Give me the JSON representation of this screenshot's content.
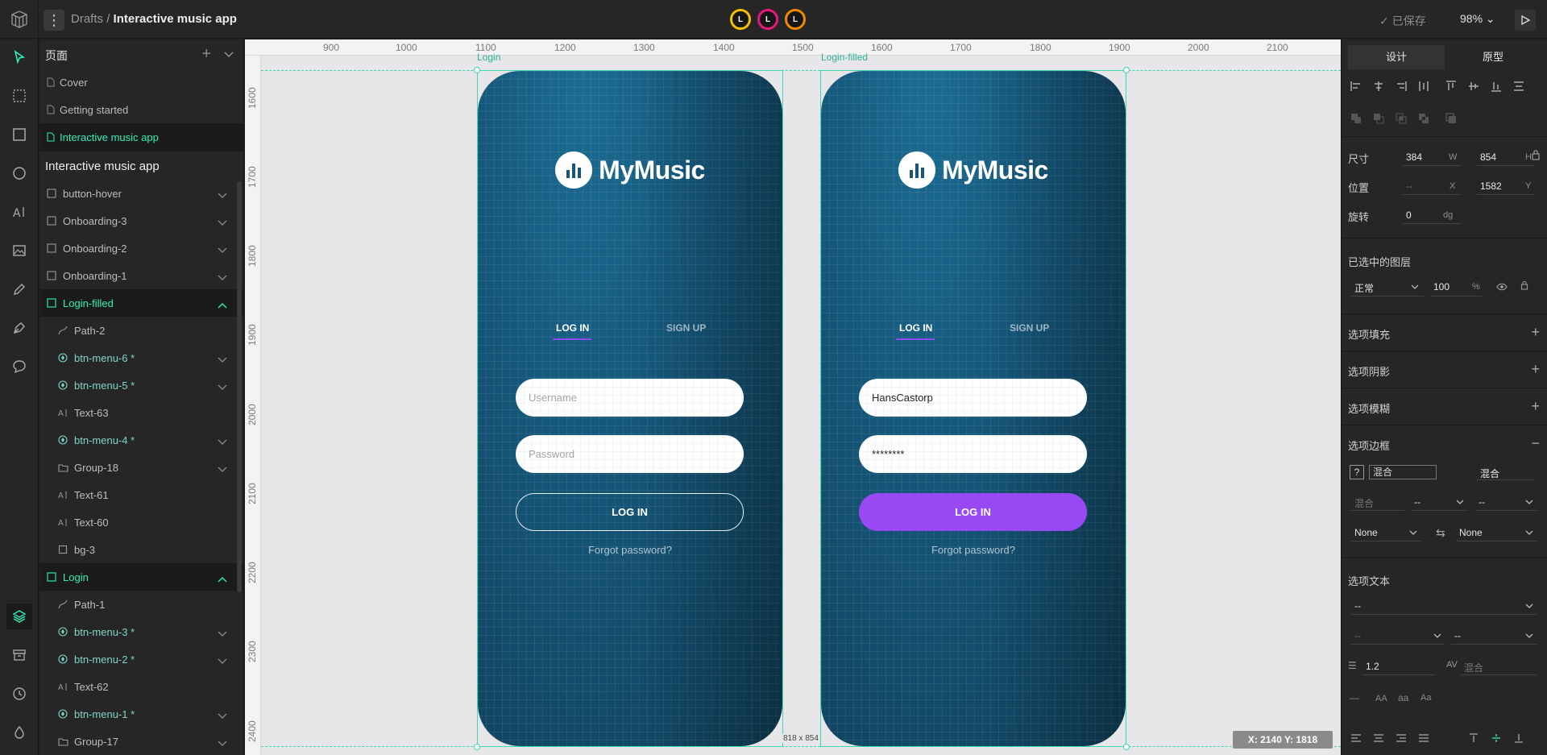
{
  "app": {
    "breadcrumb_root": "Drafts",
    "breadcrumb_sep": "/",
    "file_name": "Interactive music app",
    "saved_label": "已保存",
    "zoom": "98%",
    "collaborators": [
      {
        "initial": "L",
        "color": "#f2c200"
      },
      {
        "initial": "L",
        "color": "#e8177f"
      },
      {
        "initial": "L",
        "color": "#f08a00"
      }
    ]
  },
  "pages_panel": {
    "title": "页面",
    "pages": [
      {
        "label": "Cover",
        "active": false
      },
      {
        "label": "Getting started",
        "active": false
      },
      {
        "label": "Interactive music app",
        "active": true
      }
    ]
  },
  "layers_panel": {
    "title": "Interactive music app",
    "layers": [
      {
        "label": "button-hover",
        "kind": "board",
        "level": 0
      },
      {
        "label": "Onboarding-3",
        "kind": "board",
        "level": 0
      },
      {
        "label": "Onboarding-2",
        "kind": "board",
        "level": 0
      },
      {
        "label": "Onboarding-1",
        "kind": "board",
        "level": 0
      },
      {
        "label": "Login-filled",
        "kind": "board-active",
        "level": 0
      },
      {
        "label": "Path-2",
        "kind": "path",
        "level": 1
      },
      {
        "label": "btn-menu-6 *",
        "kind": "component",
        "level": 1
      },
      {
        "label": "btn-menu-5 *",
        "kind": "component",
        "level": 1
      },
      {
        "label": "Text-63",
        "kind": "text",
        "level": 1
      },
      {
        "label": "btn-menu-4 *",
        "kind": "component",
        "level": 1
      },
      {
        "label": "Group-18",
        "kind": "group",
        "level": 1
      },
      {
        "label": "Text-61",
        "kind": "text",
        "level": 1
      },
      {
        "label": "Text-60",
        "kind": "text",
        "level": 1
      },
      {
        "label": "bg-3",
        "kind": "rect",
        "level": 1
      },
      {
        "label": "Login",
        "kind": "board-active",
        "level": 0
      },
      {
        "label": "Path-1",
        "kind": "path",
        "level": 1
      },
      {
        "label": "btn-menu-3 *",
        "kind": "component",
        "level": 1
      },
      {
        "label": "btn-menu-2 *",
        "kind": "component",
        "level": 1
      },
      {
        "label": "Text-62",
        "kind": "text",
        "level": 1
      },
      {
        "label": "btn-menu-1 *",
        "kind": "component",
        "level": 1
      },
      {
        "label": "Group-17",
        "kind": "group",
        "level": 1
      }
    ]
  },
  "canvas": {
    "ruler_x": [
      "900",
      "1000",
      "1100",
      "1200",
      "1300",
      "1400",
      "1500",
      "1600",
      "1700",
      "1800",
      "1900",
      "2000",
      "2100"
    ],
    "ruler_y": [
      "1600",
      "1700",
      "1800",
      "1900",
      "2000",
      "2100",
      "2200",
      "2300",
      "2400"
    ],
    "dimension_badge": "818 x 854",
    "cursor_coords": "X: 2140 Y: 1818",
    "boards": [
      {
        "label": "Login",
        "brand": "MyMusic",
        "tab_login": "LOG IN",
        "tab_signup": "SIGN UP",
        "username": "Username",
        "password": "Password",
        "button": "LOG IN",
        "forgot": "Forgot password?"
      },
      {
        "label": "Login-filled",
        "brand": "MyMusic",
        "tab_login": "LOG IN",
        "tab_signup": "SIGN UP",
        "username": "HansCastorp",
        "password": "********",
        "button": "LOG IN",
        "forgot": "Forgot password?"
      }
    ]
  },
  "design_panel": {
    "tab_design": "设计",
    "tab_prototype": "原型",
    "size_label": "尺寸",
    "width": "384",
    "width_unit": "W",
    "height": "854",
    "height_unit": "H",
    "position_label": "位置",
    "pos_x": "--",
    "pos_x_unit": "X",
    "pos_y": "1582",
    "pos_y_unit": "Y",
    "rotation_label": "旋转",
    "rotation": "0",
    "rotation_unit": "dg",
    "layer_section": "已选中的图层",
    "blend_mode": "正常",
    "opacity": "100",
    "opacity_unit": "%",
    "fill_section": "选项填充",
    "shadow_section": "选项阴影",
    "blur_section": "选项模糊",
    "stroke_section": "选项边框",
    "stroke_q": "?",
    "stroke_mixed_1": "混合",
    "stroke_mixed_2": "混合",
    "stroke_mixed_3": "混合",
    "stroke_dash_1": "--",
    "stroke_dash_2": "--",
    "cap_start": "None",
    "cap_end": "None",
    "text_section": "选项文本",
    "font_family": "--",
    "font_style": "--",
    "font_size": "--",
    "line_height": "1.2",
    "letter_spacing": "混合",
    "case_aa_upper": "AA",
    "case_aa_lower": "aa",
    "case_aa_title": "Aa"
  }
}
